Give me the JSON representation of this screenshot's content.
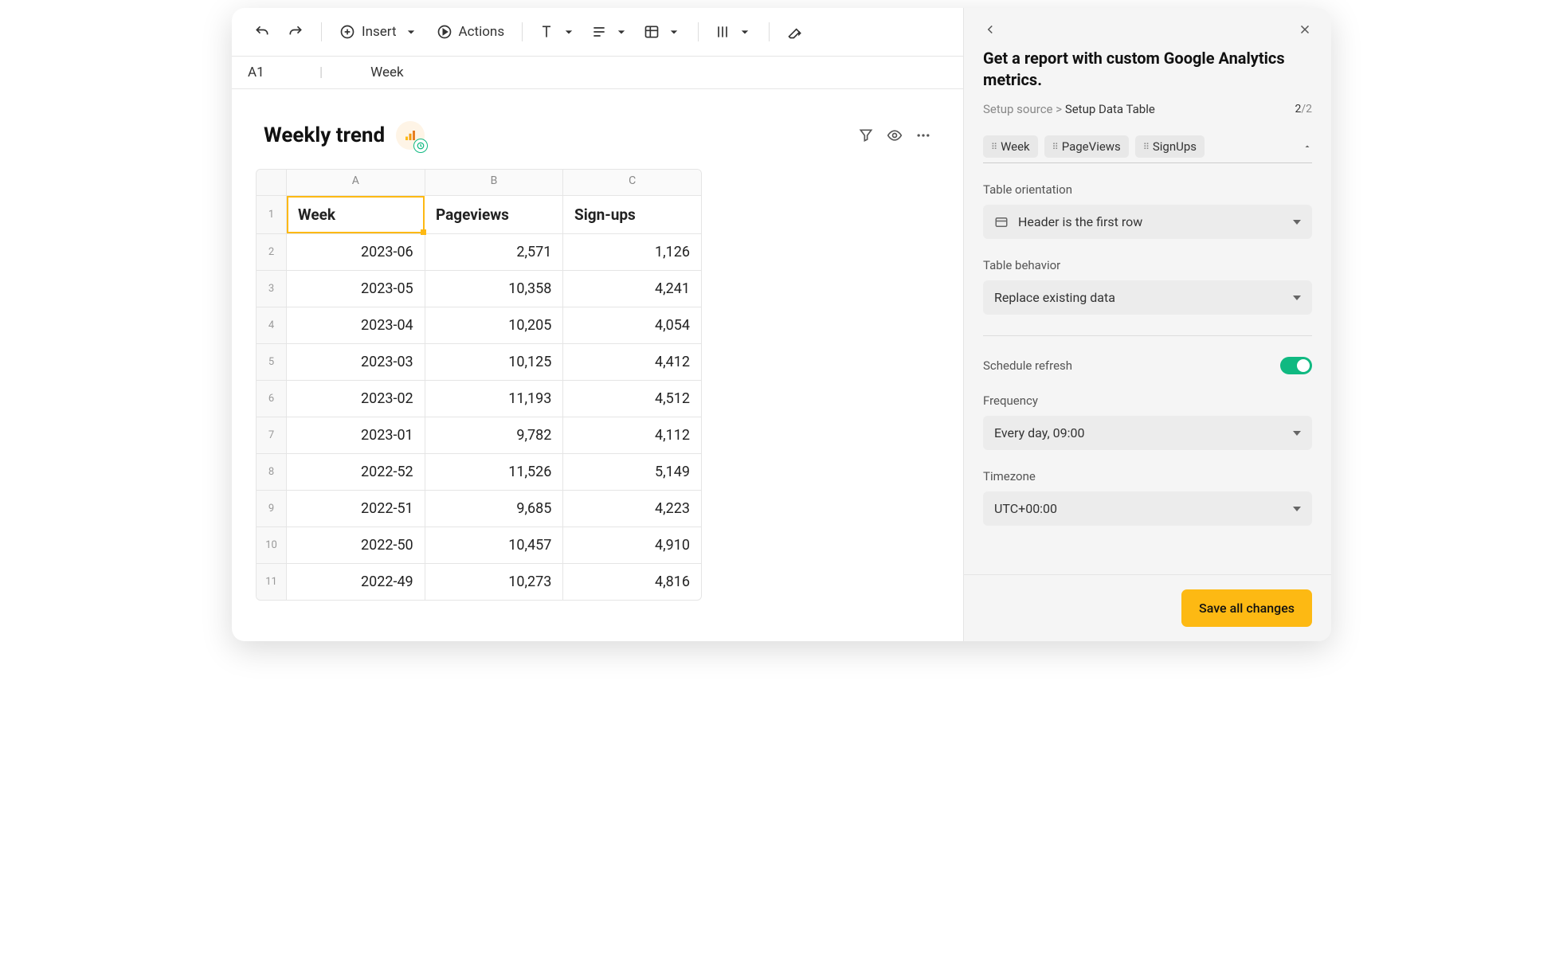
{
  "toolbar": {
    "insert_label": "Insert",
    "actions_label": "Actions"
  },
  "cellref": {
    "id": "A1",
    "value": "Week"
  },
  "table": {
    "title": "Weekly trend",
    "columns": [
      "A",
      "B",
      "C"
    ],
    "headers": [
      "Week",
      "Pageviews",
      "Sign-ups"
    ],
    "rows": [
      [
        "2023-06",
        "2,571",
        "1,126"
      ],
      [
        "2023-05",
        "10,358",
        "4,241"
      ],
      [
        "2023-04",
        "10,205",
        "4,054"
      ],
      [
        "2023-03",
        "10,125",
        "4,412"
      ],
      [
        "2023-02",
        "11,193",
        "4,512"
      ],
      [
        "2023-01",
        "9,782",
        "4,112"
      ],
      [
        "2022-52",
        "11,526",
        "5,149"
      ],
      [
        "2022-51",
        "9,685",
        "4,223"
      ],
      [
        "2022-50",
        "10,457",
        "4,910"
      ],
      [
        "2022-49",
        "10,273",
        "4,816"
      ]
    ]
  },
  "panel": {
    "title": "Get a report with custom Google Analytics metrics.",
    "breadcrumb": {
      "prev": "Setup source",
      "current": "Setup Data Table"
    },
    "step": {
      "current": "2",
      "total": "2"
    },
    "pills": [
      "Week",
      "PageViews",
      "SignUps"
    ],
    "orientation": {
      "label": "Table orientation",
      "value": "Header is the first row"
    },
    "behavior": {
      "label": "Table behavior",
      "value": "Replace existing data"
    },
    "schedule_label": "Schedule refresh",
    "frequency": {
      "label": "Frequency",
      "value": "Every day, 09:00"
    },
    "timezone": {
      "label": "Timezone",
      "value": "UTC+00:00"
    },
    "save_label": "Save all changes"
  }
}
